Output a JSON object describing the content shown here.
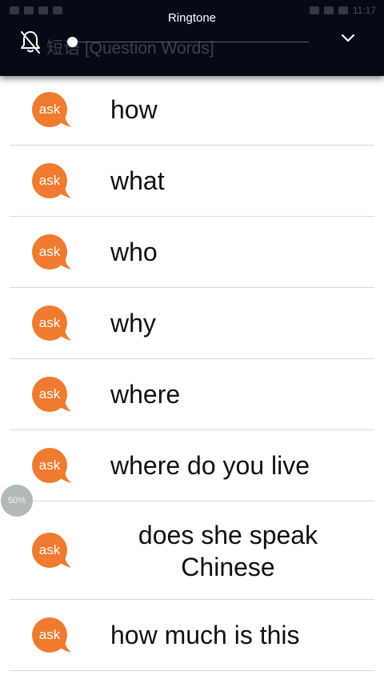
{
  "volume_panel": {
    "title": "Ringtone",
    "header_behind": "短语 [Question Words]",
    "status_time": "11:17",
    "level": 0.02
  },
  "list": {
    "items": [
      {
        "badge": "ask",
        "text": "how"
      },
      {
        "badge": "ask",
        "text": "what"
      },
      {
        "badge": "ask",
        "text": "who"
      },
      {
        "badge": "ask",
        "text": "why"
      },
      {
        "badge": "ask",
        "text": "where"
      },
      {
        "badge": "ask",
        "text": "where do you live"
      },
      {
        "badge": "ask",
        "text": "does she speak Chinese"
      },
      {
        "badge": "ask",
        "text": "how much is this"
      }
    ]
  },
  "zoom": {
    "label": "50%"
  },
  "colors": {
    "badge": "#f07b2e",
    "panel": "#050a14",
    "divider": "#d8d8d8"
  },
  "icons": {
    "ringer": "bell-off-icon",
    "collapse": "chevron-down-icon",
    "badge": "speech-bubble-icon"
  }
}
